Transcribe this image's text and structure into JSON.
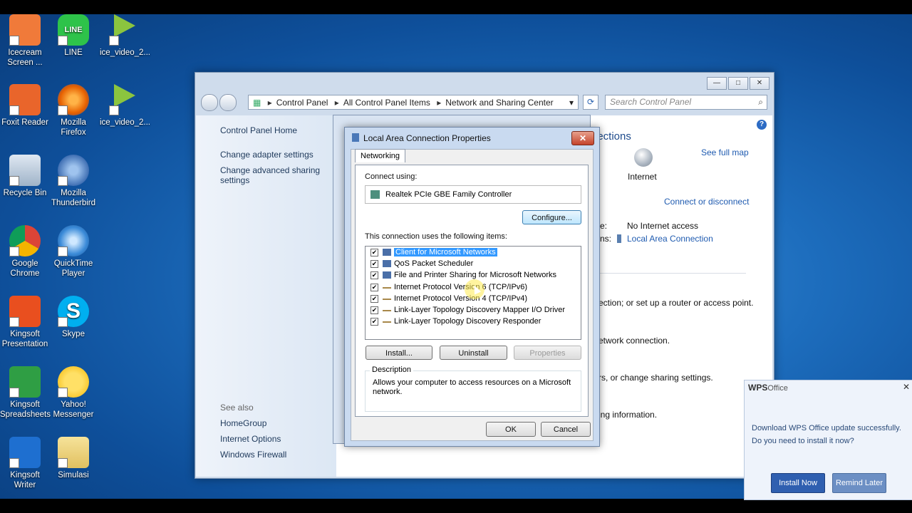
{
  "desktop_icons": [
    {
      "label": "Icecream Screen ...",
      "icon": "icecream-icon"
    },
    {
      "label": "LINE",
      "icon": "line-icon"
    },
    {
      "label": "ice_video_2...",
      "icon": "webm-icon"
    },
    {
      "label": "Foxit Reader",
      "icon": "foxit-icon"
    },
    {
      "label": "Mozilla Firefox",
      "icon": "firefox-icon"
    },
    {
      "label": "ice_video_2...",
      "icon": "webm-icon"
    },
    {
      "label": "Recycle Bin",
      "icon": "recycle-bin-icon"
    },
    {
      "label": "Mozilla Thunderbird",
      "icon": "thunderbird-icon"
    },
    {
      "label": "Google Chrome",
      "icon": "chrome-icon"
    },
    {
      "label": "QuickTime Player",
      "icon": "quicktime-icon"
    },
    {
      "label": "Kingsoft Presentation",
      "icon": "kingsoft-presentation-icon"
    },
    {
      "label": "Skype",
      "icon": "skype-icon"
    },
    {
      "label": "Kingsoft Spreadsheets",
      "icon": "kingsoft-spreadsheets-icon"
    },
    {
      "label": "Yahoo! Messenger",
      "icon": "yahoo-messenger-icon"
    },
    {
      "label": "Kingsoft Writer",
      "icon": "kingsoft-writer-icon"
    },
    {
      "label": "Simulasi",
      "icon": "folder-icon"
    }
  ],
  "icon_glyphs": {
    "line": "LINE",
    "webm": "webm",
    "skype": "S"
  },
  "explorer": {
    "breadcrumb": [
      "Control Panel",
      "All Control Panel Items",
      "Network and Sharing Center"
    ],
    "search_placeholder": "Search Control Panel",
    "left_links": [
      "Control Panel Home",
      "Change adapter settings",
      "Change advanced sharing settings"
    ],
    "see_also_title": "See also",
    "see_also": [
      "HomeGroup",
      "Internet Options",
      "Windows Firewall"
    ],
    "content": {
      "heading_fragment": "nections",
      "see_full_map": "See full map",
      "internet_label": "Internet",
      "connect_disconnect": "Connect or disconnect",
      "access_type_label": "e:",
      "access_type_value": "No Internet access",
      "connections_label": "ns:",
      "connections_value": "Local Area Connection",
      "text1": "ection; or set up a router or access point.",
      "text2": "etwork connection.",
      "text3": "rs, or change sharing settings.",
      "text4": "ing information."
    }
  },
  "dialog": {
    "title": "Local Area Connection Properties",
    "tab": "Networking",
    "connect_using_label": "Connect using:",
    "adapter": "Realtek PCIe GBE Family Controller",
    "configure": "Configure...",
    "items_label": "This connection uses the following items:",
    "items": [
      {
        "label": "Client for Microsoft Networks",
        "checked": true,
        "selected": true,
        "icon": "network-client-icon"
      },
      {
        "label": "QoS Packet Scheduler",
        "checked": true,
        "selected": false,
        "icon": "network-service-icon"
      },
      {
        "label": "File and Printer Sharing for Microsoft Networks",
        "checked": true,
        "selected": false,
        "icon": "network-service-icon"
      },
      {
        "label": "Internet Protocol Version 6 (TCP/IPv6)",
        "checked": true,
        "selected": false,
        "icon": "protocol-icon"
      },
      {
        "label": "Internet Protocol Version 4 (TCP/IPv4)",
        "checked": true,
        "selected": false,
        "icon": "protocol-icon"
      },
      {
        "label": "Link-Layer Topology Discovery Mapper I/O Driver",
        "checked": true,
        "selected": false,
        "icon": "protocol-icon"
      },
      {
        "label": "Link-Layer Topology Discovery Responder",
        "checked": true,
        "selected": false,
        "icon": "protocol-icon"
      }
    ],
    "install": "Install...",
    "uninstall": "Uninstall",
    "properties": "Properties",
    "description_title": "Description",
    "description": "Allows your computer to access resources on a Microsoft network.",
    "ok": "OK",
    "cancel": "Cancel"
  },
  "wps_popup": {
    "brand": "WPS",
    "brand_suffix": "Office",
    "message_line1": "Download WPS Office update successfully.",
    "message_line2": "Do you need to install it now?",
    "install_now": "Install Now",
    "remind_later": "Remind Later"
  }
}
